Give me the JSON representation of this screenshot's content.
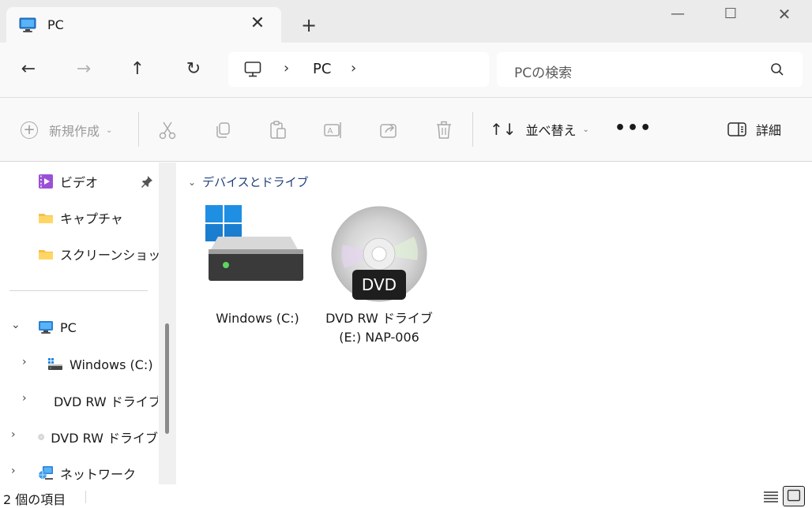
{
  "tab": {
    "title": "PC",
    "close": "✕",
    "new_tab": "+"
  },
  "window_controls": {
    "minimize": "—",
    "maximize": "☐",
    "close": "✕"
  },
  "nav": {
    "back": "←",
    "forward": "→",
    "up": "↑",
    "refresh": "↻",
    "breadcrumb": {
      "separator": "›",
      "location": "PC"
    },
    "search": {
      "placeholder": "PCの検索"
    }
  },
  "commands": {
    "new": {
      "label": "新規作成",
      "chevron": "⌄"
    },
    "sort": {
      "label": "並べ替え",
      "icon": "↑↓",
      "chevron": "⌄"
    },
    "more": "•••",
    "details": "詳細",
    "icons": [
      "cut-icon",
      "copy-icon",
      "paste-icon",
      "rename-icon",
      "share-icon",
      "delete-icon"
    ]
  },
  "sidebar": {
    "items": [
      {
        "label": "ビデオ",
        "icon": "video-icon",
        "pinned": true
      },
      {
        "label": "キャプチャ",
        "icon": "folder-icon"
      },
      {
        "label": "スクリーンショット",
        "icon": "folder-icon"
      }
    ],
    "tree": [
      {
        "label": "PC",
        "chevron": "⌄",
        "icon": "pc-icon"
      },
      {
        "label": "Windows (C:)",
        "chevron": "›",
        "icon": "drive-icon"
      },
      {
        "label": "DVD RW ドライブ",
        "chevron": "›",
        "icon": "dvd-icon"
      },
      {
        "label": "DVD RW ドライブ",
        "chevron": "›",
        "icon": "dvd-icon"
      },
      {
        "label": "ネットワーク",
        "chevron": "›",
        "icon": "network-icon"
      }
    ]
  },
  "main": {
    "group_header": "デバイスとドライブ",
    "group_chevron": "⌄",
    "drives": [
      {
        "label_line1": "Windows (C:)",
        "label_line2": "",
        "icon": "windows-drive-icon"
      },
      {
        "label_line1": "DVD RW ドライブ",
        "label_line2": "(E:) NAP-006",
        "icon": "dvd-drive-icon",
        "badge": "DVD"
      }
    ]
  },
  "status": {
    "item_count": "2 個の項目"
  },
  "colors": {
    "accent": "#0067c0",
    "titlebar": "#ebebeb",
    "toolbar": "#f9f9f9",
    "folder": "#f5c04a"
  }
}
